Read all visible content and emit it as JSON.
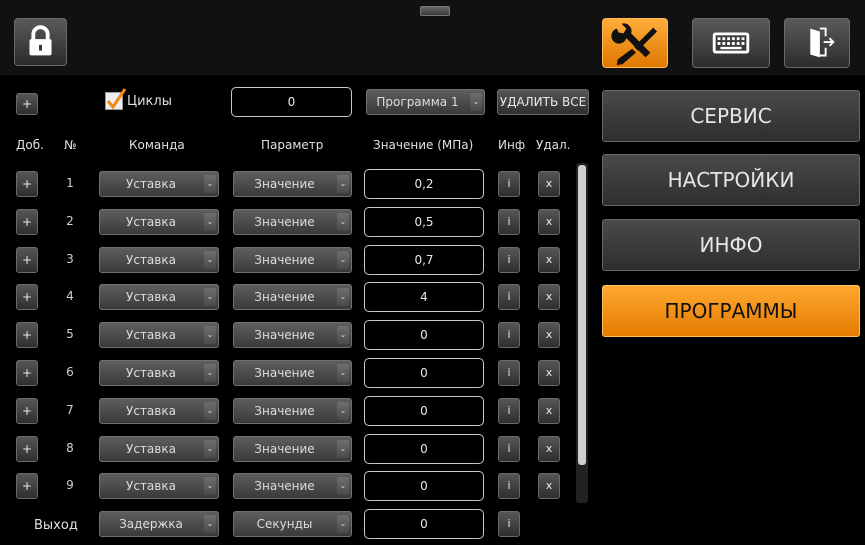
{
  "toolbar": {
    "lock_icon": "lock-icon",
    "tools_icon": "wrench-screwdriver-icon",
    "keyboard_icon": "keyboard-icon",
    "exit_icon": "exit-door-icon",
    "accent_color": "#f28a0d"
  },
  "controls": {
    "add_label": "+",
    "cycles_label": "Циклы",
    "cycles_checked": true,
    "cycles_value": "0",
    "program_select": "Программа 1",
    "delete_all_label": "УДАЛИТЬ ВСЕ"
  },
  "table": {
    "headers": {
      "add": "Доб.",
      "num": "№",
      "command": "Команда",
      "param": "Параметр",
      "value": "Значение (МПа)",
      "info": "Инф",
      "delete": "Удал."
    },
    "rows": [
      {
        "add": "+",
        "num": "1",
        "command": "Уставка",
        "param": "Значение",
        "value": "0,2",
        "info": "i",
        "del": "x"
      },
      {
        "add": "+",
        "num": "2",
        "command": "Уставка",
        "param": "Значение",
        "value": "0,5",
        "info": "i",
        "del": "x"
      },
      {
        "add": "+",
        "num": "3",
        "command": "Уставка",
        "param": "Значение",
        "value": "0,7",
        "info": "i",
        "del": "x"
      },
      {
        "add": "+",
        "num": "4",
        "command": "Уставка",
        "param": "Значение",
        "value": "4",
        "info": "i",
        "del": "x"
      },
      {
        "add": "+",
        "num": "5",
        "command": "Уставка",
        "param": "Значение",
        "value": "0",
        "info": "i",
        "del": "x"
      },
      {
        "add": "+",
        "num": "6",
        "command": "Уставка",
        "param": "Значение",
        "value": "0",
        "info": "i",
        "del": "x"
      },
      {
        "add": "+",
        "num": "7",
        "command": "Уставка",
        "param": "Значение",
        "value": "0",
        "info": "i",
        "del": "x"
      },
      {
        "add": "+",
        "num": "8",
        "command": "Уставка",
        "param": "Значение",
        "value": "0",
        "info": "i",
        "del": "x"
      },
      {
        "add": "+",
        "num": "9",
        "command": "Уставка",
        "param": "Значение",
        "value": "0",
        "info": "i",
        "del": "x"
      }
    ],
    "exit_row": {
      "label": "Выход",
      "command": "Задержка",
      "param": "Секунды",
      "value": "0",
      "info": "i"
    }
  },
  "menu": {
    "service": "СЕРВИС",
    "settings": "НАСТРОЙКИ",
    "info": "ИНФО",
    "programs": "ПРОГРАММЫ"
  }
}
